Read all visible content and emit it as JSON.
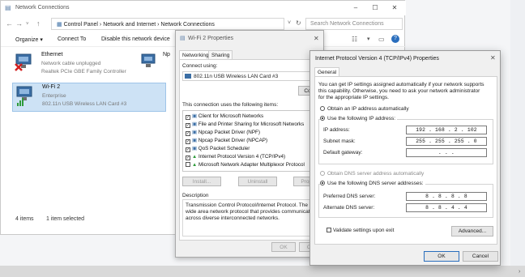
{
  "explorer": {
    "title": "Network Connections",
    "address": "Control Panel  ›  Network and Internet  ›  Network Connections",
    "search_placeholder": "Search Network Connections",
    "commands": {
      "organize": "Organize ▾",
      "connect_to": "Connect To",
      "disable": "Disable this network device"
    },
    "adapters": [
      {
        "name": "Ethernet",
        "status": "Network cable unplugged",
        "device": "Realtek PCIe GBE Family Controller"
      },
      {
        "name": "Wi-Fi 2",
        "status": "Enterprise",
        "device": "802.11n USB Wireless LAN Card #3"
      },
      {
        "name": "Np",
        "status": "",
        "device": ""
      }
    ],
    "status": {
      "items": "4 items",
      "selected": "1 item selected"
    }
  },
  "wifi_props": {
    "title": "Wi-Fi 2 Properties",
    "tabs": [
      "Networking",
      "Sharing"
    ],
    "connect_using_label": "Connect using:",
    "adapter_name": "802.11n USB Wireless LAN Card #3",
    "configure_label": "Confi",
    "items_label": "This connection uses the following items:",
    "items": [
      {
        "label": "Client for Microsoft Networks",
        "checked": true
      },
      {
        "label": "File and Printer Sharing for Microsoft Networks",
        "checked": true
      },
      {
        "label": "Npcap Packet Driver (NPF)",
        "checked": true
      },
      {
        "label": "Npcap Packet Driver (NPCAP)",
        "checked": true
      },
      {
        "label": "QoS Packet Scheduler",
        "checked": true
      },
      {
        "label": "Internet Protocol Version 4 (TCP/IPv4)",
        "checked": true
      },
      {
        "label": "Microsoft Network Adapter Multiplexor Protocol",
        "checked": false
      }
    ],
    "install_label": "Install...",
    "uninstall_label": "Uninstall",
    "properties_label": "Prope",
    "description_label": "Description",
    "description_lines": [
      "Transmission Control Protocol/Internet Protocol. The defa",
      "wide area network protocol that provides communicatio",
      "across diverse interconnected networks."
    ],
    "ok_label": "OK",
    "cancel_label": "Ca"
  },
  "ipv4": {
    "title": "Internet Protocol Version 4 (TCP/IPv4) Properties",
    "tab": "General",
    "intro_lines": [
      "You can get IP settings assigned automatically if your network supports",
      "this capability. Otherwise, you need to ask your network administrator",
      "for the appropriate IP settings."
    ],
    "auto_ip_label": "Obtain an IP address automatically",
    "use_ip_label": "Use the following IP address:",
    "ip_address_label": "IP address:",
    "ip_address": "192 . 168 .  2  . 102",
    "subnet_label": "Subnet mask:",
    "subnet": "255 . 255 . 255 .  0",
    "gateway_label": "Default gateway:",
    "gateway": " .     .     . ",
    "auto_dns_label": "Obtain DNS server address automatically",
    "use_dns_label": "Use the following DNS server addresses:",
    "pref_dns_label": "Preferred DNS server:",
    "pref_dns": "8 .  8  .  8  .  8",
    "alt_dns_label": "Alternate DNS server:",
    "alt_dns": "8 .  8  .  4  .  4",
    "validate_label": "Validate settings upon exit",
    "advanced_label": "Advanced...",
    "ok_label": "OK",
    "cancel_label": "Cancel"
  }
}
